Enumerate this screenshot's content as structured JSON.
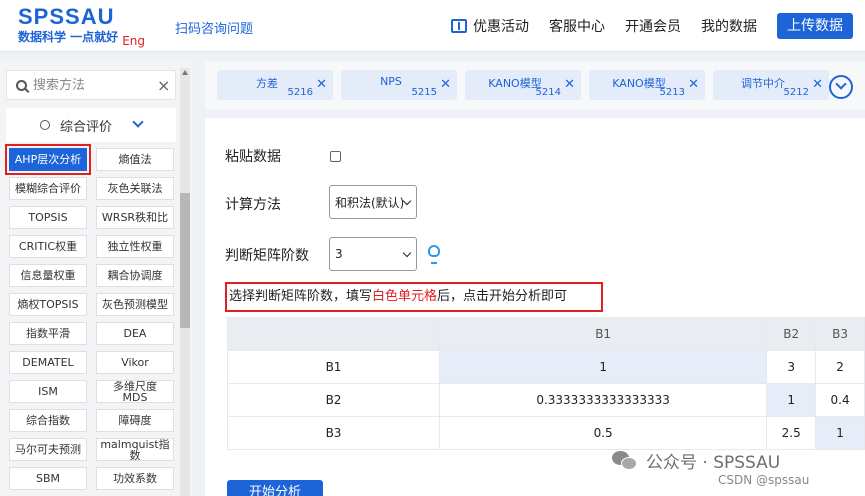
{
  "header": {
    "logo": "SPSSAU",
    "slogan": "数据科学 一点就好",
    "eng": "Eng",
    "scan_link": "扫码咨询问题",
    "nav": [
      "优惠活动",
      "客服中心",
      "开通会员",
      "我的数据"
    ],
    "upload": "上传数据"
  },
  "sidebar": {
    "search_placeholder": "搜索方法",
    "clear": "×",
    "category": "综合评价",
    "methods": [
      "AHP层次分析",
      "熵值法",
      "模糊综合评价",
      "灰色关联法",
      "TOPSIS",
      "WRSR秩和比",
      "CRITIC权重",
      "独立性权重",
      "信息量权重",
      "耦合协调度",
      "熵权TOPSIS",
      "灰色预测模型",
      "指数平滑",
      "DEA",
      "DEMATEL",
      "Vikor",
      "ISM",
      "多维尺度\nMDS",
      "综合指数",
      "障碍度",
      "马尔可夫预测",
      "malmquist指\n数",
      "SBM",
      "功效系数"
    ],
    "active_method": "AHP层次分析"
  },
  "tabs": [
    {
      "name": "方差",
      "id": "5216"
    },
    {
      "name": "NPS",
      "id": "5215"
    },
    {
      "name": "KANO模型",
      "id": "5214"
    },
    {
      "name": "KANO模型",
      "id": "5213"
    },
    {
      "name": "调节中介",
      "id": "5212"
    }
  ],
  "form": {
    "paste_label": "粘贴数据",
    "method_label": "计算方法",
    "method_value": "和积法(默认)",
    "order_label": "判断矩阵阶数",
    "order_value": "3",
    "hint_pre": "选择判断矩阵阶数，填写",
    "hint_red": "白色单元格",
    "hint_post": "后，点击开始分析即可"
  },
  "matrix": {
    "columns": [
      "B1",
      "B2",
      "B3"
    ],
    "rows": [
      {
        "label": "B1",
        "values": [
          "1",
          "3",
          "2"
        ]
      },
      {
        "label": "B2",
        "values": [
          "0.3333333333333333",
          "1",
          "0.4"
        ]
      },
      {
        "label": "B3",
        "values": [
          "0.5",
          "2.5",
          "1"
        ]
      }
    ]
  },
  "start_button": "开始分析",
  "watermark": {
    "text": "公众号 · SPSSAU",
    "csdn": "CSDN @spssau"
  },
  "colors": {
    "accent": "#1d64d8",
    "highlight": "#e02020"
  }
}
